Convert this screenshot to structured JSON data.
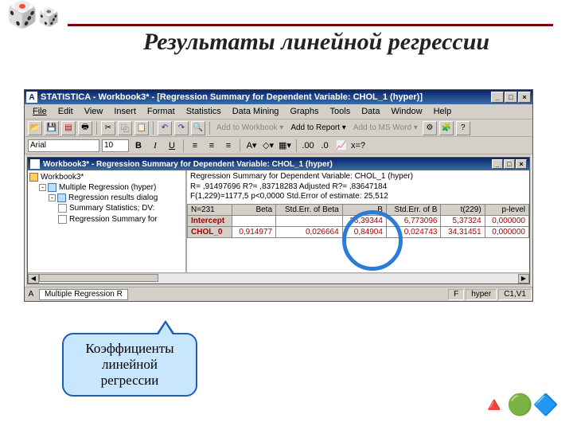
{
  "slide": {
    "title": "Результаты линейной регрессии",
    "callout": "Коэффициенты линейной регрессии"
  },
  "window": {
    "title": "STATISTICA - Workbook3* - [Regression Summary for Dependent Variable: CHOL_1 (hyper)]",
    "menu": [
      "File",
      "Edit",
      "View",
      "Insert",
      "Format",
      "Statistics",
      "Data Mining",
      "Graphs",
      "Tools",
      "Data",
      "Window",
      "Help"
    ],
    "toolbar": {
      "add_workbook": "Add to Workbook ▾",
      "add_report": "Add to Report ▾",
      "add_word": "Add to MS Word ▾"
    },
    "format": {
      "font": "Arial",
      "size": "10"
    }
  },
  "inner": {
    "title": "Workbook3* - Regression Summary for Dependent Variable: CHOL_1 (hyper)",
    "tree": [
      "Workbook3*",
      "Multiple Regression (hyper)",
      "Regression results dialog",
      "Summary Statistics; DV:",
      "Regression Summary for"
    ],
    "summary": {
      "line1": "Regression Summary for Dependent Variable: CHOL_1 (hyper)",
      "line2": "R= ,91497696 R?= ,83718283 Adjusted R?= ,83647184",
      "line3": "F(1,229)=1177,5 p<0,0000 Std.Error of estimate: 25,512"
    },
    "n_label": "N=231",
    "columns": [
      "Beta",
      "Std.Err. of Beta",
      "B",
      "Std.Err. of B",
      "t(229)",
      "p-level"
    ],
    "rows": [
      {
        "name": "Intercept",
        "vals": [
          "",
          "",
          "36,39344",
          "6,773096",
          "5,37324",
          "0,000000"
        ]
      },
      {
        "name": "CHOL_0",
        "vals": [
          "0,914977",
          "0,026664",
          "0,84904",
          "0,024743",
          "34,31451",
          "0,000000"
        ]
      }
    ]
  },
  "status": {
    "tab": "Multiple Regression R",
    "f": "F",
    "hyper": "hyper",
    "cell": "C1,V1"
  }
}
